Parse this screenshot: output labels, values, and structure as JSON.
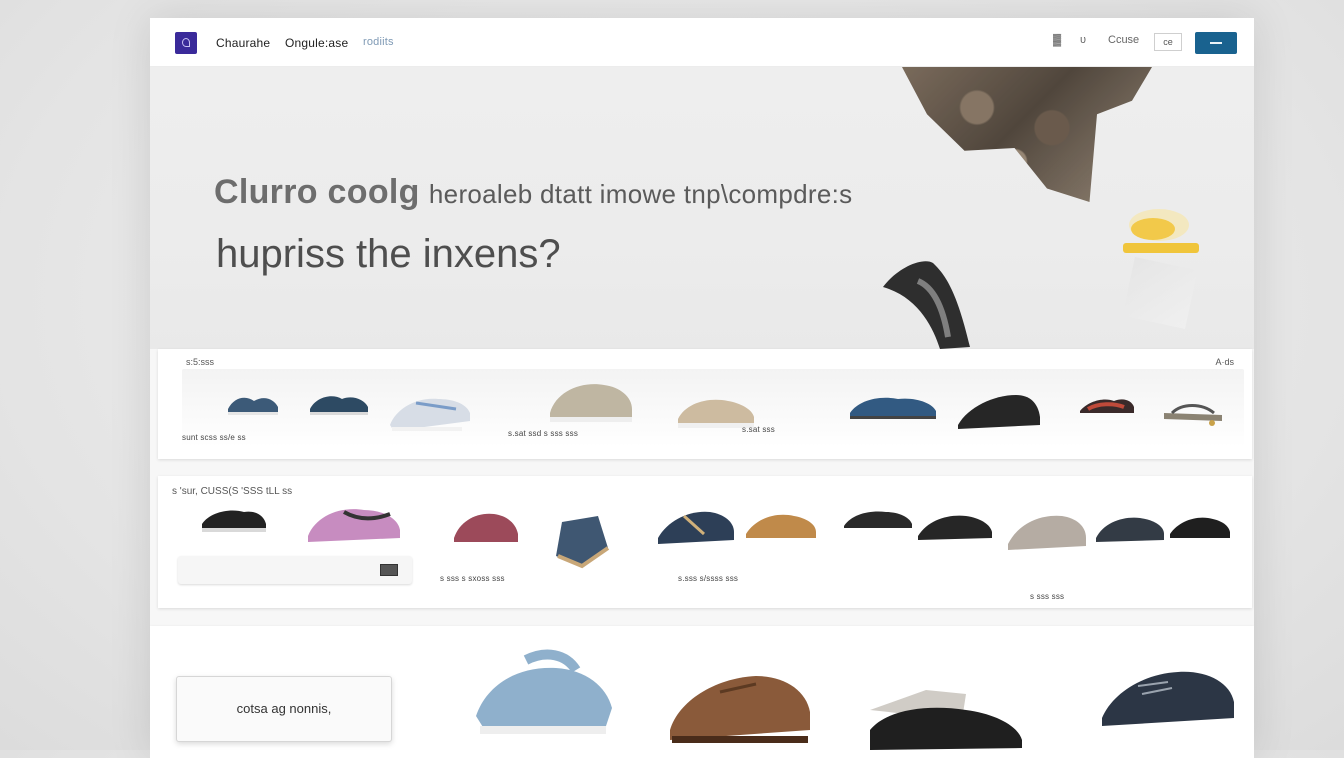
{
  "nav": {
    "links": [
      "Chaurahe",
      "Ongule:ase",
      "rodiits"
    ],
    "util": [
      "▓",
      "ᴜ",
      "Ccuse"
    ],
    "box_label": "ce"
  },
  "hero": {
    "line1_bold": "Clurro coolg",
    "line1_rest": "heroaleb dtatt imowe tnp\\compdre:s",
    "line2": "hupriss the inxens?"
  },
  "panel1": {
    "label_left": "s:5:sss",
    "label_right": "A·ds",
    "captions": [
      "sunt scss ss/e ss",
      "s.sat ssd s sss sss",
      "s.sat sss"
    ]
  },
  "panel2": {
    "heading": "s 'sur, CUSS(S 'SSS tLL ss",
    "captions": [
      "s sss s sxoss sss",
      "s.sss s/ssss sss",
      "s sss sss"
    ]
  },
  "panel3": {
    "box_label": "cotsa ag nonnis,"
  },
  "colors": {
    "accent": "#19628f",
    "logo": "#3a2a9a"
  }
}
